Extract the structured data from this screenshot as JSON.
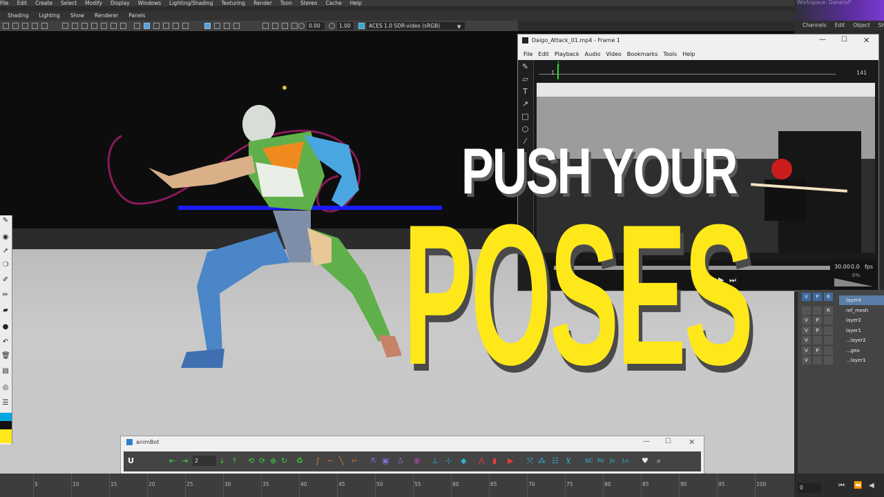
{
  "menubar": {
    "items": [
      "File",
      "Edit",
      "Create",
      "Select",
      "Modify",
      "Display",
      "Windows",
      "Lighting/Shading",
      "Texturing",
      "Render",
      "Toon",
      "Stereo",
      "Cache",
      "Help"
    ]
  },
  "workspace": {
    "label": "Workspace: General*"
  },
  "viewport_menu": {
    "items": [
      "Shading",
      "Lighting",
      "Show",
      "Renderer",
      "Panels"
    ]
  },
  "viewport_toolbar": {
    "field_a": "0.00",
    "field_b": "1.00",
    "color_space": "ACES 1.0 SDR-video (sRGB)"
  },
  "channel_box": {
    "tabs": [
      "Channels",
      "Edit",
      "Object",
      "Show"
    ]
  },
  "player": {
    "title": "Daigo_Attack_01.mp4 - Frame 1",
    "menu": [
      "File",
      "Edit",
      "Playback",
      "Audio",
      "Video",
      "Bookmarks",
      "Tools",
      "Help"
    ],
    "frame_start": "1",
    "frame_end": "141",
    "frame_marker": "1",
    "fps_value": "30.00",
    "fps_extra": "0.0",
    "fps_unit": "fps",
    "volume": "0%"
  },
  "layers": {
    "header": [
      "V",
      "P",
      "R"
    ],
    "rows": [
      {
        "v": "",
        "p": "",
        "r": "",
        "name": "layer4",
        "selected": true
      },
      {
        "v": "",
        "p": "",
        "r": "R",
        "name": "ref_mesh",
        "selected": false
      },
      {
        "v": "V",
        "p": "P",
        "r": "",
        "name": "layer2",
        "selected": false
      },
      {
        "v": "V",
        "p": "P",
        "r": "",
        "name": "layer1",
        "selected": false
      },
      {
        "v": "V",
        "p": "",
        "r": "",
        "name": "...layer2",
        "selected": false
      },
      {
        "v": "V",
        "p": "P",
        "r": "",
        "name": "...geo",
        "selected": false
      },
      {
        "v": "V",
        "p": "",
        "r": "",
        "name": "...layer1",
        "selected": false
      }
    ]
  },
  "animbot": {
    "title": "animBot",
    "step_value": "2",
    "labels": [
      "NC",
      "Po",
      "Jo",
      "Lo"
    ]
  },
  "timeline": {
    "ticks": [
      "5",
      "10",
      "15",
      "20",
      "25",
      "30",
      "35",
      "40",
      "45",
      "50",
      "55",
      "60",
      "65",
      "70",
      "75",
      "80",
      "85",
      "90",
      "95",
      "100"
    ],
    "current_frame": "0"
  },
  "headline": {
    "line1": "PUSH YOUR",
    "line2": "POSES"
  },
  "colors": {
    "headline_yellow": "#ffe81a",
    "headline_white": "#ffffff",
    "animbot_accent": "#2bb3d8"
  }
}
